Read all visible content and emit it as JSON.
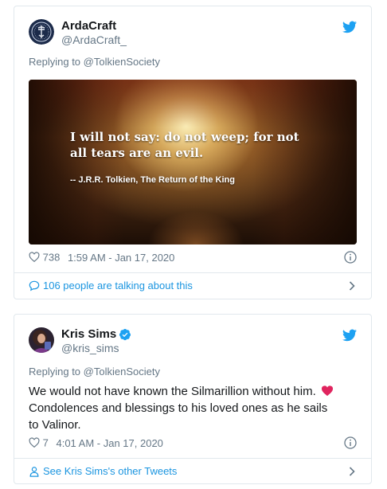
{
  "colors": {
    "twitter_blue": "#1da1f2",
    "link_blue": "#1b95e0",
    "muted_gray": "#657786",
    "text": "#14171a",
    "border": "#e1e8ed",
    "heart_red": "#e0245e"
  },
  "tweets": [
    {
      "display_name": "ArdaCraft",
      "handle": "@ArdaCraft_",
      "verified": false,
      "avatar_icon": "arda-emblem-avatar",
      "replying_prefix": "Replying to ",
      "replying_to": "@TolkienSociety",
      "image": {
        "quote": "I will not say: do not weep; for not all tears are an evil.",
        "attribution": "-- J.R.R. Tolkien, The Return of the King"
      },
      "likes": "738",
      "timestamp": "1:59 AM - Jan 17, 2020",
      "footer_link": "106 people are talking about this",
      "footer_icon": "speech-bubble-icon"
    },
    {
      "display_name": "Kris Sims",
      "handle": "@kris_sims",
      "verified": true,
      "avatar_icon": "user-photo-avatar",
      "replying_prefix": "Replying to ",
      "replying_to": "@TolkienSociety",
      "text": "We would not have known the Silmarillion without him.",
      "text_emoji": "red-heart",
      "text_cont": "Condolences and blessings to his loved ones as he sails to Valinor.",
      "likes": "7",
      "timestamp": "4:01 AM - Jan 17, 2020",
      "footer_link": "See Kris Sims's other Tweets",
      "footer_icon": "person-icon"
    }
  ]
}
